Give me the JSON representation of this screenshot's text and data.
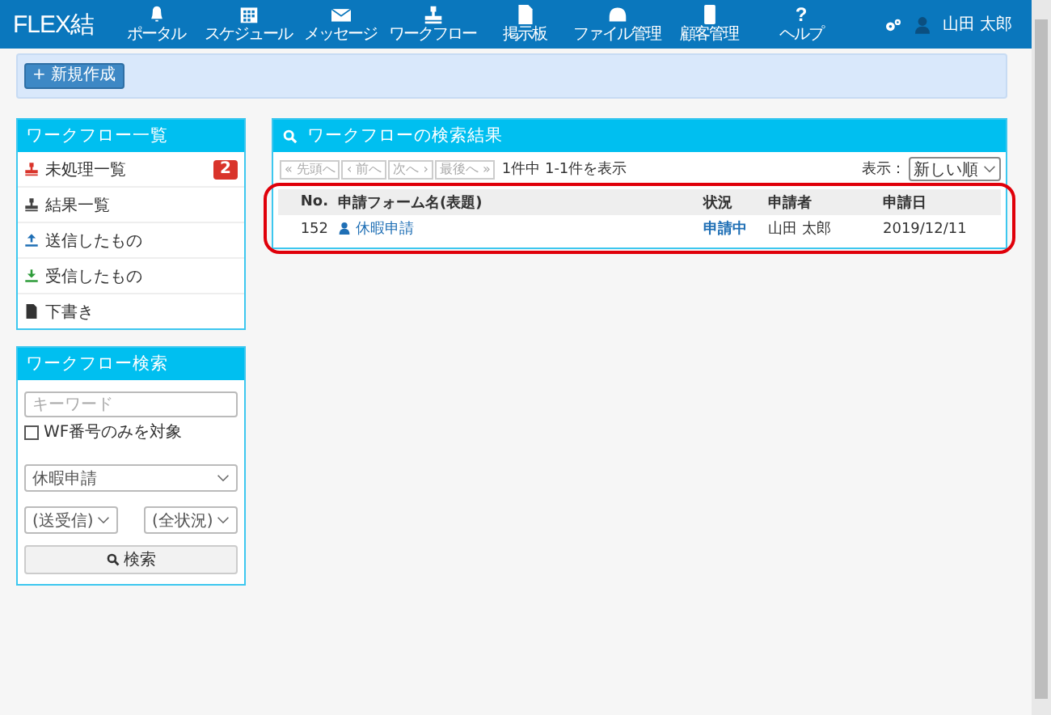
{
  "header": {
    "logo": "FLEX結",
    "nav": [
      {
        "label": "ポータル",
        "kind": "bell"
      },
      {
        "label": "スケジュール",
        "kind": "calendar"
      },
      {
        "label": "メッセージ",
        "kind": "envelope"
      },
      {
        "label": "ワークフロー",
        "kind": "stamp"
      },
      {
        "label": "掲示板",
        "kind": "document"
      },
      {
        "label": "ファイル管理",
        "kind": "drive"
      },
      {
        "label": "顧客管理",
        "kind": "tablet"
      },
      {
        "label": "ヘルプ",
        "kind": "help",
        "glyph": "?"
      }
    ],
    "user": "山田 太郎"
  },
  "toolbar": {
    "new_button": "+ 新規作成"
  },
  "workflow_list": {
    "title": "ワークフロー一覧",
    "items": [
      {
        "label": "未処理一覧",
        "kind": "stamp",
        "color": "#d9342b",
        "badge": "2"
      },
      {
        "label": "結果一覧",
        "kind": "stamp",
        "color": "#444444"
      },
      {
        "label": "送信したもの",
        "kind": "upload",
        "color": "#1f6fb5"
      },
      {
        "label": "受信したもの",
        "kind": "download",
        "color": "#2e9c3a"
      },
      {
        "label": "下書き",
        "kind": "file",
        "color": "#333333"
      }
    ]
  },
  "search": {
    "title": "ワークフロー検索",
    "keyword": {
      "placeholder": "キーワード"
    },
    "wf_only": {
      "label": "WF番号のみを対象",
      "checked": false
    },
    "form_select": "休暇申請",
    "direction_select": "(送受信)",
    "status_select": "(全状況)",
    "button": "検索"
  },
  "results": {
    "title": "ワークフローの検索結果",
    "pager": [
      {
        "label": "« 先頭へ",
        "disabled": true
      },
      {
        "label": "‹ 前へ",
        "disabled": true
      },
      {
        "label": "次へ ›",
        "disabled": true
      },
      {
        "label": "最後へ »",
        "disabled": true
      }
    ],
    "count": "1件中 1-1件を表示",
    "sort_label": "表示：",
    "sort_select": "新しい順",
    "columns": [
      "No.",
      "申請フォーム名(表題)",
      "状況",
      "申請者",
      "申請日"
    ],
    "rows": [
      {
        "no": "152",
        "form": "休暇申請",
        "status": "申請中",
        "applicant": "山田 太郎",
        "date": "2019/12/11"
      }
    ],
    "annotation": {
      "kind": "outline"
    }
  }
}
